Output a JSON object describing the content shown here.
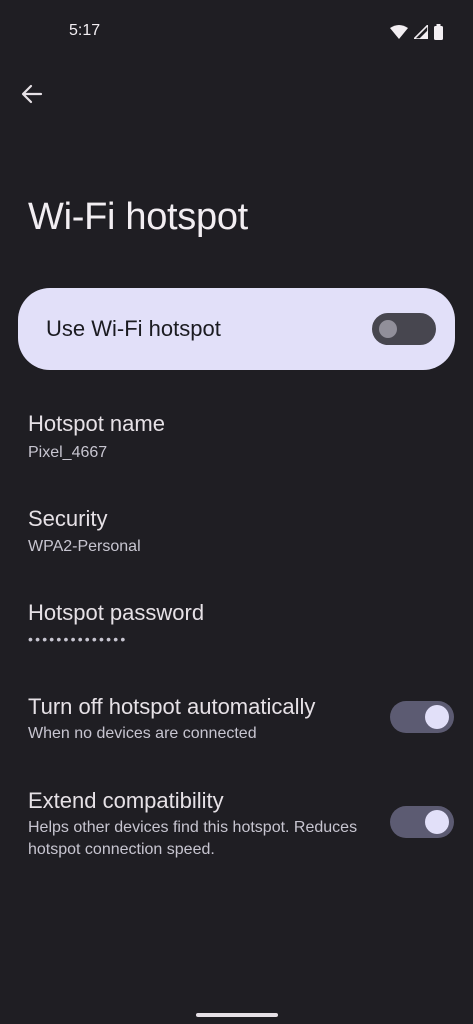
{
  "status_bar": {
    "time": "5:17",
    "icons": [
      "wifi-icon",
      "cellular-signal-icon",
      "battery-icon"
    ]
  },
  "header": {
    "back_icon": "arrow-back-icon",
    "title": "Wi-Fi hotspot"
  },
  "main_toggle": {
    "label": "Use Wi-Fi hotspot",
    "enabled": false
  },
  "settings": {
    "hotspot_name": {
      "title": "Hotspot name",
      "value": "Pixel_4667"
    },
    "security": {
      "title": "Security",
      "value": "WPA2-Personal"
    },
    "hotspot_password": {
      "title": "Hotspot password",
      "value": "••••••••••••••"
    },
    "auto_off": {
      "title": "Turn off hotspot automatically",
      "summary": "When no devices are connected",
      "enabled": true
    },
    "extend_compat": {
      "title": "Extend compatibility",
      "summary": "Helps other devices find this hotspot. Reduces hotspot connection speed.",
      "enabled": true
    }
  },
  "colors": {
    "background": "#1f1e23",
    "card": "#e2e0f9",
    "switch_on_track": "#5c5b72",
    "switch_off_track": "#47464f"
  }
}
